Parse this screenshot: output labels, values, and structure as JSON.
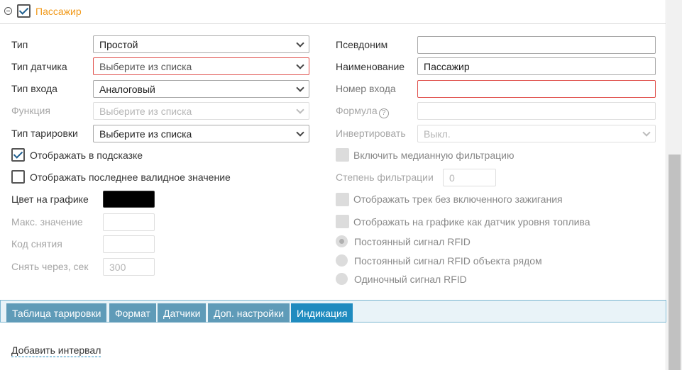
{
  "section": {
    "title": "Пассажир",
    "enabled": true
  },
  "left": {
    "type": {
      "label": "Тип",
      "value": "Простой"
    },
    "sensor_type": {
      "label": "Тип датчика",
      "value": "Выберите из списка"
    },
    "input_type": {
      "label": "Тип входа",
      "value": "Аналоговый"
    },
    "function": {
      "label": "Функция",
      "value": "Выберите из списка"
    },
    "calibration_type": {
      "label": "Тип тарировки",
      "value": "Выберите из списка"
    },
    "show_in_tooltip": {
      "label": "Отображать в подсказке",
      "checked": true
    },
    "show_last_valid": {
      "label": "Отображать последнее валидное значение",
      "checked": false
    },
    "chart_color": {
      "label": "Цвет на графике",
      "color": "#000000"
    },
    "max_value": {
      "label": "Макс. значение",
      "value": ""
    },
    "removal_code": {
      "label": "Код снятия",
      "value": ""
    },
    "remove_after": {
      "label": "Снять через, сек",
      "value": "300"
    }
  },
  "right": {
    "alias": {
      "label": "Псевдоним",
      "value": ""
    },
    "name": {
      "label": "Наименование",
      "value": "Пассажир"
    },
    "input_number": {
      "label": "Номер входа",
      "value": ""
    },
    "formula": {
      "label": "Формула",
      "value": ""
    },
    "invert": {
      "label": "Инвертировать",
      "value": "Выкл."
    },
    "median_filter": {
      "label": "Включить медианную фильтрацию"
    },
    "filter_degree": {
      "label": "Степень фильтрации",
      "value": "0"
    },
    "track_without_ignition": {
      "label": "Отображать трек без включенного зажигания"
    },
    "fuel_level_chart": {
      "label": "Отображать на графике как датчик уровня топлива"
    },
    "rfid_options": [
      {
        "label": "Постоянный сигнал RFID",
        "selected": true
      },
      {
        "label": "Постоянный сигнал RFID объекта рядом",
        "selected": false
      },
      {
        "label": "Одиночный сигнал RFID",
        "selected": false
      }
    ]
  },
  "tabs": [
    {
      "label": "Таблица тарировки",
      "active": false
    },
    {
      "label": "Формат",
      "active": false
    },
    {
      "label": "Датчики",
      "active": false
    },
    {
      "label": "Доп. настройки",
      "active": false
    },
    {
      "label": "Индикация",
      "active": true
    }
  ],
  "add_interval_link": "Добавить интервал",
  "colors": {
    "accent": "#f19a1b",
    "tab": "#5f9bb8",
    "tab_active": "#1f8bbf",
    "error": "#e0524e"
  }
}
